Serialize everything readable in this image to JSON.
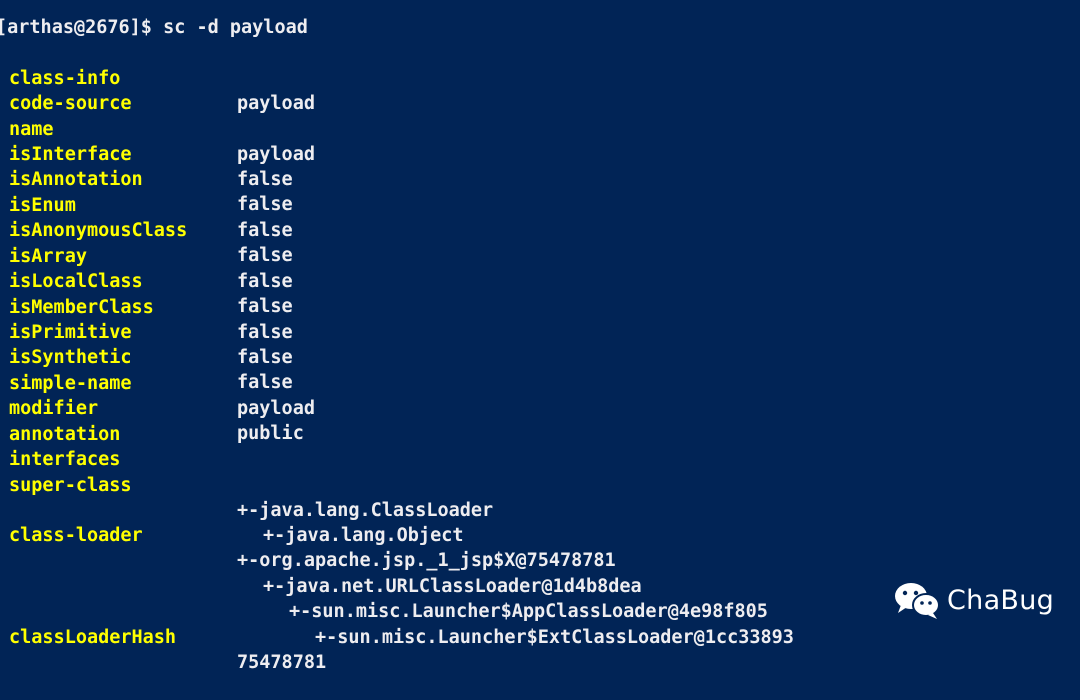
{
  "command": "[arthas@2676]$ sc -d payload",
  "rows": [
    {
      "key": "class-info",
      "value": "payload"
    },
    {
      "key": "code-source",
      "value": ""
    },
    {
      "key": "name",
      "value": "payload"
    },
    {
      "key": "isInterface",
      "value": "false"
    },
    {
      "key": "isAnnotation",
      "value": "false"
    },
    {
      "key": "isEnum",
      "value": "false"
    },
    {
      "key": "isAnonymousClass",
      "value": "false"
    },
    {
      "key": "isArray",
      "value": "false"
    },
    {
      "key": "isLocalClass",
      "value": "false"
    },
    {
      "key": "isMemberClass",
      "value": "false"
    },
    {
      "key": "isPrimitive",
      "value": "false"
    },
    {
      "key": "isSynthetic",
      "value": "false"
    },
    {
      "key": "simple-name",
      "value": "payload"
    },
    {
      "key": "modifier",
      "value": "public"
    },
    {
      "key": "annotation",
      "value": ""
    },
    {
      "key": "interfaces",
      "value": ""
    },
    {
      "key": "super-class",
      "value": "+-java.lang.ClassLoader"
    },
    {
      "key": "",
      "value": "+-java.lang.Object"
    },
    {
      "key": "class-loader",
      "value": "+-org.apache.jsp._1_jsp$X@75478781"
    },
    {
      "key": "",
      "value": "+-java.net.URLClassLoader@1d4b8dea"
    },
    {
      "key": "",
      "value": "+-sun.misc.Launcher$AppClassLoader@4e98f805"
    },
    {
      "key": "",
      "value": "+-sun.misc.Launcher$ExtClassLoader@1cc33893"
    },
    {
      "key": "classLoaderHash",
      "value": "75478781"
    }
  ],
  "watermark": {
    "text": "ChaBug",
    "icon": "wechat-icon"
  },
  "colors": {
    "background": "#012456",
    "key": "#ffff00",
    "value": "#eeedf0"
  }
}
